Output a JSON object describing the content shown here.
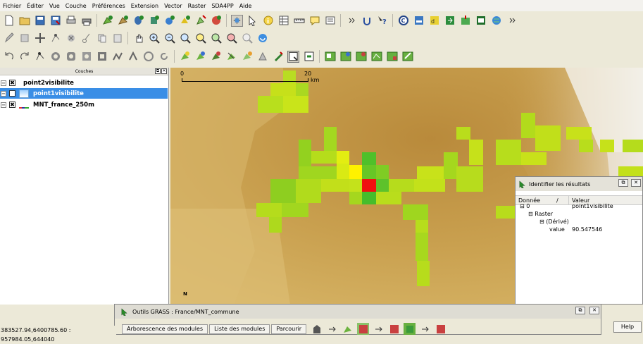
{
  "menu": [
    "Fichier",
    "Éditer",
    "Vue",
    "Couche",
    "Préférences",
    "Extension",
    "Vector",
    "Raster",
    "SDA4PP",
    "Aide"
  ],
  "layers_panel": {
    "title": "Couches",
    "layers": [
      {
        "name": "point2visibilite",
        "checked": "✖",
        "selected": false
      },
      {
        "name": "point1visibilite",
        "checked": "",
        "selected": true
      },
      {
        "name": "MNT_france_250m",
        "checked": "✖",
        "selected": false
      }
    ]
  },
  "scale_bar": {
    "start": "0",
    "end": "20",
    "unit": "km"
  },
  "north_label": "N",
  "identify": {
    "title": "Identifier les résultats",
    "col_donnee": "Donnée",
    "col_sort": "/",
    "col_valeur": "Valeur",
    "rows": [
      {
        "key": "⊟ 0",
        "value": "point1visibilite"
      },
      {
        "key": "⊟ Raster",
        "value": ""
      },
      {
        "key": "⊟ (Dérivé)",
        "value": ""
      },
      {
        "key": "value",
        "value": "90.547546"
      }
    ]
  },
  "grass": {
    "title": "Outils GRASS : France/MNT_commune",
    "tabs": [
      "Arborescence des modules",
      "Liste des modules",
      "Parcourir"
    ]
  },
  "status_coords": "383527.94,6400785.60 : 957984.05,644040",
  "help_label": "Help",
  "colors": {
    "selection": "#3a8ee6",
    "terrain": "#c79b4b",
    "visibility_high": "#ff0000",
    "visibility_mid": "#ffee00",
    "visibility_low": "#7cd400"
  }
}
